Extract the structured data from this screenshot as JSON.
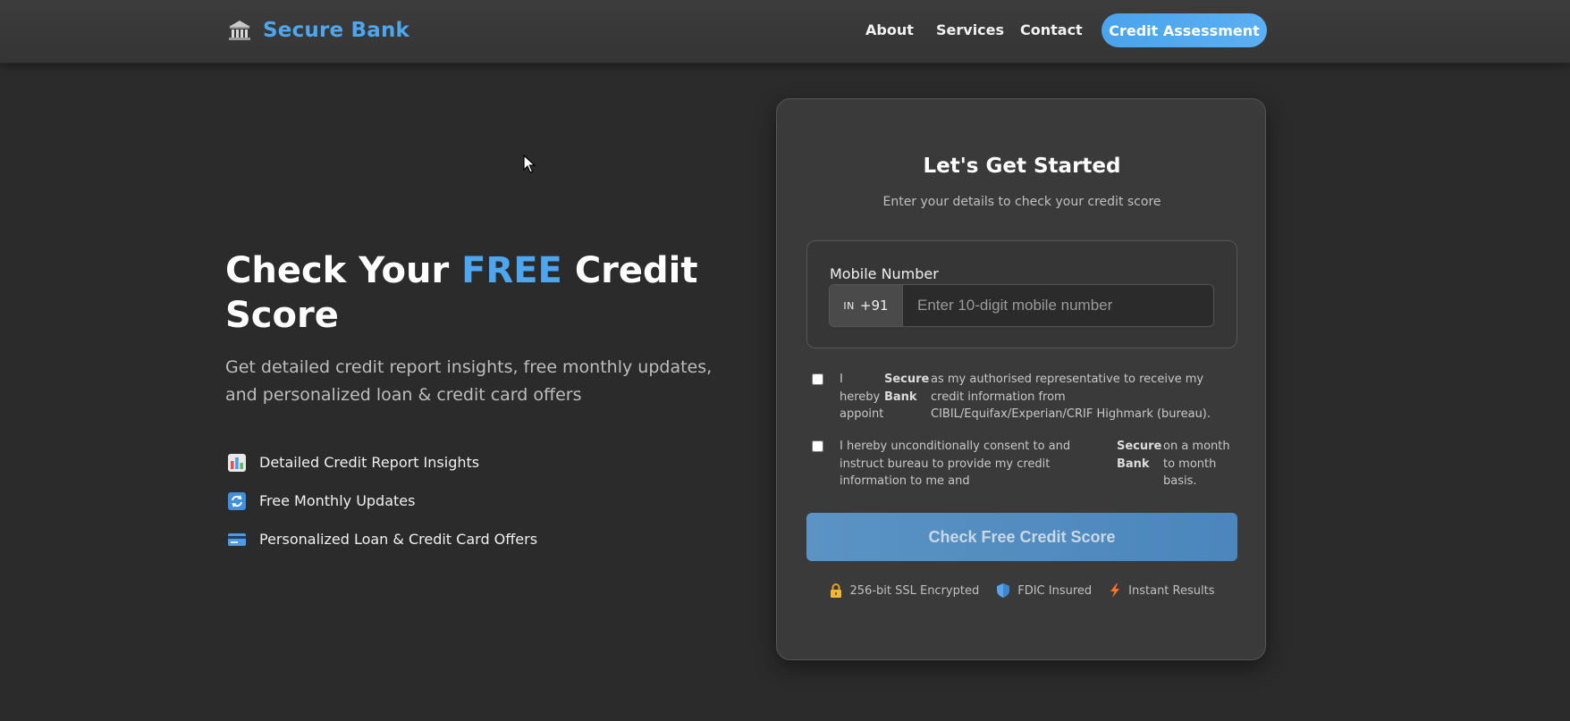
{
  "nav": {
    "brand": "Secure Bank",
    "brand_icon": "bank-building-icon",
    "links": [
      "About",
      "Services",
      "Contact"
    ],
    "cta": "Credit Assessment"
  },
  "hero": {
    "title_prefix": "Check Your ",
    "title_highlight": "FREE",
    "title_suffix": " Credit Score",
    "subtitle": "Get detailed credit report insights, free monthly updates, and personalized loan & credit card offers",
    "features": [
      {
        "icon": "bar-chart-icon",
        "text": "Detailed Credit Report Insights"
      },
      {
        "icon": "refresh-icon",
        "text": "Free Monthly Updates"
      },
      {
        "icon": "credit-card-icon",
        "text": "Personalized Loan & Credit Card Offers"
      }
    ]
  },
  "form": {
    "title": "Let's Get Started",
    "subtitle": "Enter your details to check your credit score",
    "mobile_label": "Mobile Number",
    "country_flag": "IN",
    "country_code": "+91",
    "mobile_placeholder": "Enter 10-digit mobile number",
    "mobile_value": "",
    "consent1": {
      "checked": false,
      "part1": "I hereby appoint",
      "bold": "Secure Bank",
      "part2": "as my authorised representative to receive my credit information from CIBIL/Equifax/Experian/CRIF Highmark (bureau)."
    },
    "consent2": {
      "checked": false,
      "part1": "I hereby unconditionally consent to and instruct bureau to provide my credit information to me and",
      "bold": "Secure Bank",
      "part2": "on a month to month basis."
    },
    "submit": "Check Free Credit Score",
    "badges": [
      {
        "icon": "lock-icon",
        "text": "256-bit SSL Encrypted"
      },
      {
        "icon": "shield-icon",
        "text": "FDIC Insured"
      },
      {
        "icon": "lightning-icon",
        "text": "Instant Results"
      }
    ]
  },
  "colors": {
    "accent": "#4da6ee",
    "background": "#2b2b2b",
    "card": "#3a3a3a"
  }
}
